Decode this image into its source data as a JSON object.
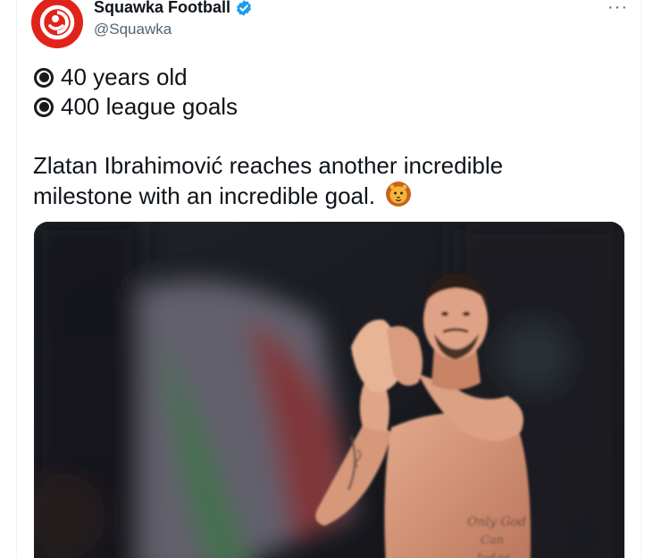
{
  "account": {
    "display_name": "Squawka Football",
    "handle": "@Squawka",
    "verified": true,
    "avatar_icon": "squawka-logo-icon",
    "brand_color": "#e2231a"
  },
  "header": {
    "more_icon": "more-dots-icon",
    "more_glyph": "···"
  },
  "tweet": {
    "bullets": [
      {
        "icon": "radio-bullet-icon",
        "text": "40 years old"
      },
      {
        "icon": "radio-bullet-icon",
        "text": "400 league goals"
      }
    ],
    "paragraph_line1": "Zlatan Ibrahimović reaches another incredible",
    "paragraph_line2": "milestone with an incredible goal.",
    "emoji": "lion-face-icon"
  },
  "media": {
    "type": "photo",
    "subject": "player-applauding-photo"
  },
  "colors": {
    "text": "#0f1419",
    "secondary_text": "#536471",
    "verified_blue": "#1d9bf0"
  }
}
